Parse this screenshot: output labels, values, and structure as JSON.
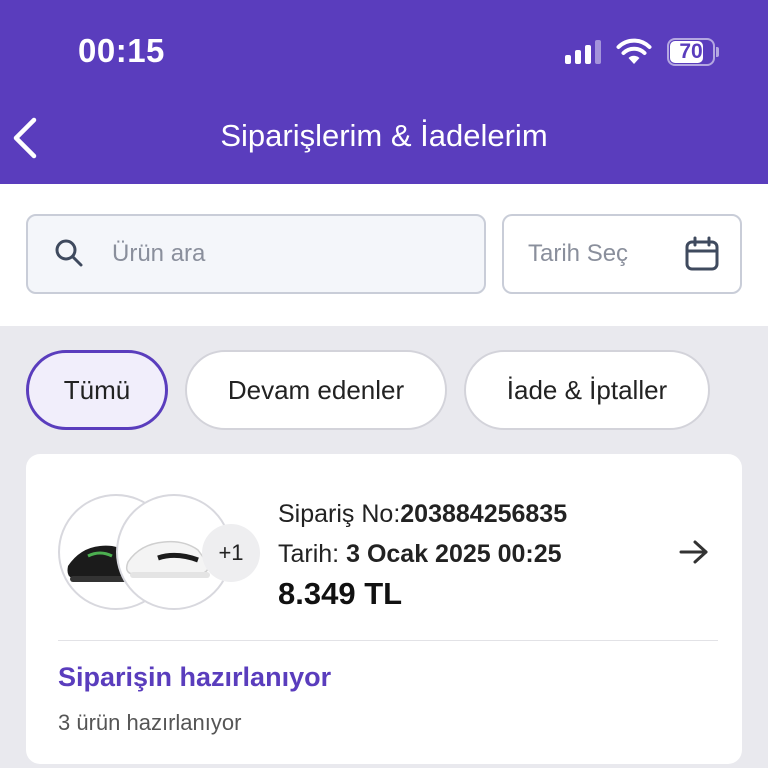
{
  "status_bar": {
    "time": "00:15",
    "battery": "70"
  },
  "header": {
    "title": "Siparişlerim & İadelerim"
  },
  "search": {
    "placeholder": "Ürün ara",
    "date_placeholder": "Tarih Seç"
  },
  "filters": [
    {
      "label": "Tümü",
      "active": true
    },
    {
      "label": "Devam edenler",
      "active": false
    },
    {
      "label": "İade & İptaller",
      "active": false
    }
  ],
  "order": {
    "order_no_label": "Sipariş No:",
    "order_no": "203884256835",
    "date_label": "Tarih:",
    "date": "3 Ocak 2025 00:25",
    "price": "8.349 TL",
    "extra_count": "+1",
    "status_title": "Siparişin hazırlanıyor",
    "status_sub": "3 ürün hazırlanıyor"
  },
  "colors": {
    "accent": "#5a3dbd"
  }
}
